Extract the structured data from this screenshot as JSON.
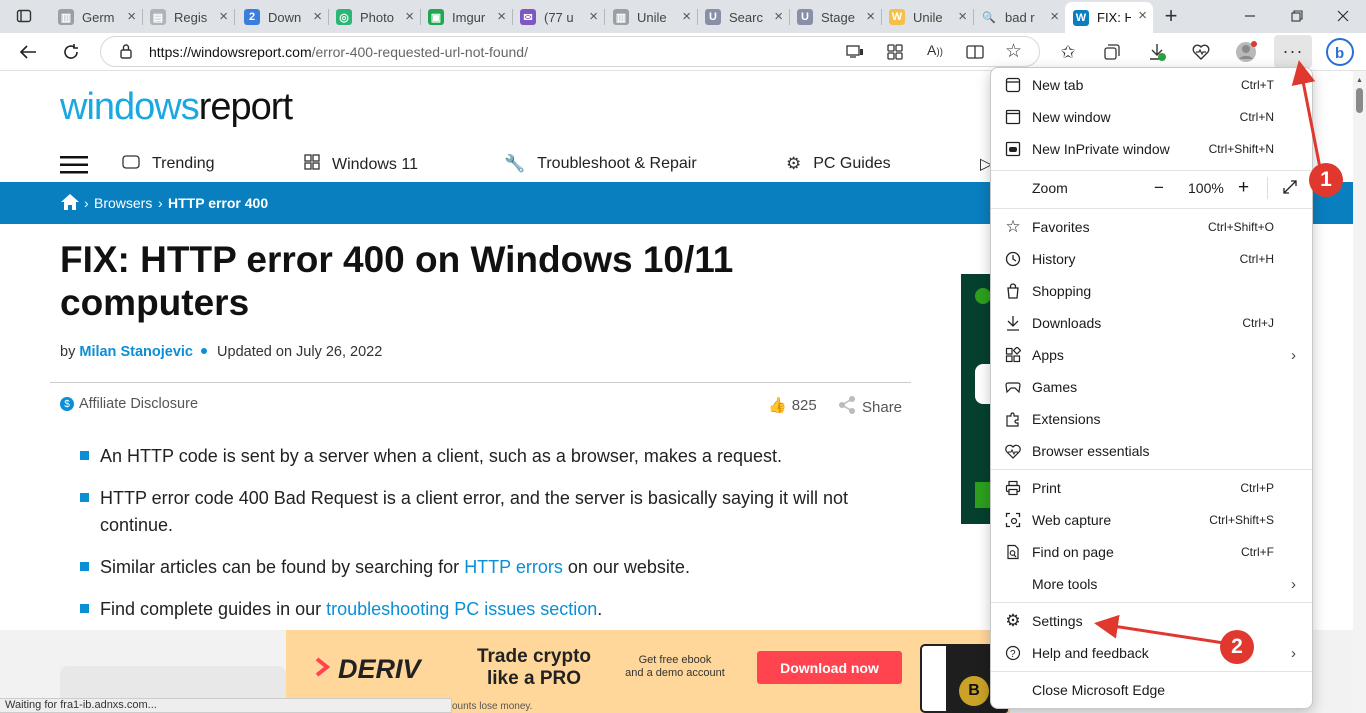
{
  "tabs": [
    {
      "label": "Germ",
      "fav": "▥",
      "color": "#9aa0a6"
    },
    {
      "label": "Regis",
      "fav": "▤",
      "color": "#b0b4b9"
    },
    {
      "label": "Down",
      "fav": "2",
      "color": "#3b7ddd"
    },
    {
      "label": "Photo",
      "fav": "◎",
      "color": "#2bb673"
    },
    {
      "label": "Imgur",
      "fav": "▣",
      "color": "#1fa84f"
    },
    {
      "label": "(77 u",
      "fav": "✉",
      "color": "#7e57c2"
    },
    {
      "label": "Unile",
      "fav": "▥",
      "color": "#9aa0a6"
    },
    {
      "label": "Searc",
      "fav": "U",
      "color": "#8a8fa8"
    },
    {
      "label": "Stage",
      "fav": "U",
      "color": "#8a8fa8"
    },
    {
      "label": "Unile",
      "fav": "W",
      "color": "#f5c04a"
    },
    {
      "label": "bad r",
      "fav": "🔍",
      "color": "#dfe3e8"
    },
    {
      "label": "FIX: H",
      "fav": "W",
      "color": "#0a7fbf"
    }
  ],
  "address": {
    "url_host": "https://windowsreport.com",
    "url_path": "/error-400-requested-url-not-found/"
  },
  "site": {
    "logo_part1": "windows",
    "logo_part2": "report",
    "nav": [
      "Trending",
      "Windows 11",
      "Troubleshoot & Repair",
      "PC Guides"
    ],
    "breadcrumb": [
      "Browsers",
      "HTTP error 400"
    ]
  },
  "article": {
    "title": "FIX: HTTP error 400 on Windows 10/11 computers",
    "by": "by",
    "author": "Milan Stanojevic",
    "updated": "Updated on July 26, 2022",
    "disclosure": "Affiliate Disclosure",
    "likes": "825",
    "share": "Share",
    "bullets": [
      {
        "pre": "An HTTP code is sent by a server when a client, such as a browser, makes a request.",
        "link": "",
        "post": ""
      },
      {
        "pre": "HTTP error code 400 Bad Request is a client error, and the server is basically saying it will not continue.",
        "link": "",
        "post": ""
      },
      {
        "pre": "Similar articles can be found by searching for ",
        "link": "HTTP errors",
        "post": " on our website."
      },
      {
        "pre": "Find complete guides in our ",
        "link": "troubleshooting PC issues section",
        "post": "."
      }
    ]
  },
  "ad": {
    "brand": "DERIV",
    "headline_1": "Trade crypto",
    "headline_2": "like a PRO",
    "sub_1": "Get free ebook",
    "sub_2": "and a demo account",
    "cta": "Download now",
    "fine": "ounts lose money."
  },
  "status": "Waiting for fra1-ib.adnxs.com...",
  "menu": {
    "new_tab": {
      "label": "New tab",
      "shortcut": "Ctrl+T"
    },
    "new_window": {
      "label": "New window",
      "shortcut": "Ctrl+N"
    },
    "inprivate": {
      "label": "New InPrivate window",
      "shortcut": "Ctrl+Shift+N"
    },
    "zoom": {
      "label": "Zoom",
      "value": "100%"
    },
    "favorites": {
      "label": "Favorites",
      "shortcut": "Ctrl+Shift+O"
    },
    "history": {
      "label": "History",
      "shortcut": "Ctrl+H"
    },
    "shopping": {
      "label": "Shopping"
    },
    "downloads": {
      "label": "Downloads",
      "shortcut": "Ctrl+J"
    },
    "apps": {
      "label": "Apps"
    },
    "games": {
      "label": "Games"
    },
    "extensions": {
      "label": "Extensions"
    },
    "essentials": {
      "label": "Browser essentials"
    },
    "print": {
      "label": "Print",
      "shortcut": "Ctrl+P"
    },
    "web_capture": {
      "label": "Web capture",
      "shortcut": "Ctrl+Shift+S"
    },
    "find": {
      "label": "Find on page",
      "shortcut": "Ctrl+F"
    },
    "more_tools": {
      "label": "More tools"
    },
    "settings": {
      "label": "Settings"
    },
    "help": {
      "label": "Help and feedback"
    },
    "close": {
      "label": "Close Microsoft Edge"
    }
  },
  "annotations": {
    "badge1": "1",
    "badge2": "2",
    "color": "#e0382e"
  }
}
